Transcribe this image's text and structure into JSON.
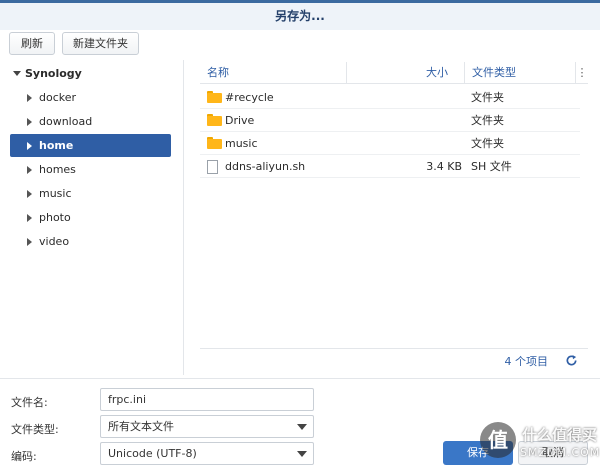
{
  "window": {
    "title": "另存为..."
  },
  "toolbar": {
    "refresh_label": "刷新",
    "new_folder_label": "新建文件夹"
  },
  "tree": {
    "root": "Synology",
    "items": [
      {
        "label": "docker",
        "selected": false
      },
      {
        "label": "download",
        "selected": false
      },
      {
        "label": "home",
        "selected": true
      },
      {
        "label": "homes",
        "selected": false
      },
      {
        "label": "music",
        "selected": false
      },
      {
        "label": "photo",
        "selected": false
      },
      {
        "label": "video",
        "selected": false
      }
    ]
  },
  "filelist": {
    "columns": {
      "name": "名称",
      "size": "大小",
      "type": "文件类型",
      "menu": "⋮"
    },
    "rows": [
      {
        "icon": "folder-icon",
        "name": "#recycle",
        "size": "",
        "type": "文件夹"
      },
      {
        "icon": "folder-icon",
        "name": "Drive",
        "size": "",
        "type": "文件夹"
      },
      {
        "icon": "folder-icon",
        "name": "music",
        "size": "",
        "type": "文件夹"
      },
      {
        "icon": "file-icon",
        "name": "ddns-aliyun.sh",
        "size": "3.4 KB",
        "type": "SH 文件"
      }
    ],
    "count": "4 个项目"
  },
  "form": {
    "filename_label": "文件名:",
    "filename_value": "frpc.ini",
    "filetype_label": "文件类型:",
    "filetype_value": "所有文本文件",
    "encoding_label": "编码:",
    "encoding_value": "Unicode (UTF-8)"
  },
  "buttons": {
    "save": "保存",
    "cancel": "取消"
  },
  "watermark": {
    "glyph": "值",
    "line1": "什么值得买",
    "line2": "SMZDM.COM"
  },
  "colors": {
    "accent": "#2f5ea5",
    "folder": "#ffb619",
    "primary_button": "#3a77c7"
  }
}
